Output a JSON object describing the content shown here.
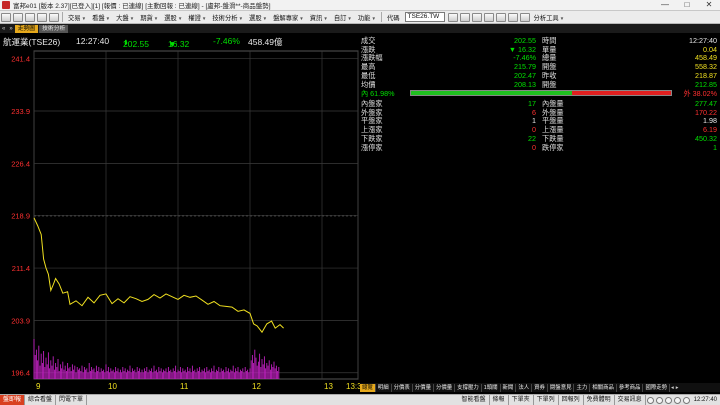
{
  "window": {
    "title": "富邦e01 [版本 2.37][已登入][1] [報價 : 已連線] [主動回報 : 已連線] - [盧邦-盤滑**-商品盤勢]",
    "minimize": "—",
    "maximize": "□",
    "close": "✕"
  },
  "menu": {
    "items": [
      "交易",
      "看盤",
      "大盤",
      "期貨",
      "選股",
      "權證",
      "技術分析",
      "選股",
      "盤解專家",
      "資訊",
      "自訂",
      "功能"
    ],
    "code_label": "代碼",
    "code_value": "TSE26.TW",
    "analysis_tools": "分析工具"
  },
  "tabs": {
    "items": [
      {
        "label": "走勢圖",
        "active": true
      },
      {
        "label": "技術分析",
        "active": false
      }
    ]
  },
  "stock": {
    "name": "航運業(TSE26)",
    "time": "12:27:40",
    "price": "202.55",
    "price_arrow": "⬇",
    "change_arrow": "▼",
    "change": "16.32",
    "change_pct": "-7.46%",
    "volume": "458.49億"
  },
  "quote": {
    "left": [
      {
        "label": "成交",
        "value": "202.55",
        "color": "g",
        "arrow": "⬇"
      },
      {
        "label": "漲跌",
        "value": "▼ 16.32",
        "color": "g"
      },
      {
        "label": "漲跌幅",
        "value": "-7.46%",
        "color": "g"
      },
      {
        "label": "最高",
        "value": "215.79",
        "color": "g"
      },
      {
        "label": "最低",
        "value": "202.47",
        "color": "g"
      },
      {
        "label": "均價",
        "value": "208.13",
        "color": "g"
      }
    ],
    "right": [
      {
        "label": "時間",
        "value": "12:27:40",
        "color": "w"
      },
      {
        "label": "單量",
        "value": "0.04",
        "color": "y"
      },
      {
        "label": "總量",
        "value": "458.49",
        "color": "y"
      },
      {
        "label": "開盤",
        "value": "558.32",
        "color": "y"
      },
      {
        "label": "昨收",
        "value": "218.87",
        "color": "y"
      },
      {
        "label": "開盤",
        "value": "212.85",
        "color": "g"
      }
    ],
    "inner_label": "內 61.98%",
    "outer_label": "外 38.02%",
    "inner_ratio": 0.6198,
    "stats_left": [
      {
        "label": "內盤家",
        "value": "17",
        "color": "g"
      },
      {
        "label": "外盤家",
        "value": "6",
        "color": "r"
      },
      {
        "label": "平盤家",
        "value": "1",
        "color": "w"
      },
      {
        "label": "上漲家",
        "value": "0",
        "color": "r"
      },
      {
        "label": "下跌家",
        "value": "22",
        "color": "g"
      },
      {
        "label": "漲停家",
        "value": "0",
        "color": "r"
      }
    ],
    "stats_right": [
      {
        "label": "內盤量",
        "value": "277.47",
        "color": "g"
      },
      {
        "label": "外盤量",
        "value": "170.22",
        "color": "r"
      },
      {
        "label": "平盤量",
        "value": "1.98",
        "color": "w"
      },
      {
        "label": "上漲量",
        "value": "6.19",
        "color": "r"
      },
      {
        "label": "下跌量",
        "value": "450.32",
        "color": "g"
      },
      {
        "label": "跌停家",
        "value": "1",
        "color": "g"
      }
    ]
  },
  "chart_data": {
    "type": "line",
    "ylim": [
      195.5,
      242.5
    ],
    "y_ticks": [
      "241.4",
      "233.9",
      "226.4",
      "218.9",
      "211.4",
      "203.9",
      "196.4"
    ],
    "y_tick_values": [
      241.4,
      233.9,
      226.4,
      218.9,
      211.4,
      203.9,
      196.4
    ],
    "x_ticks": [
      "9",
      "10",
      "11",
      "12",
      "13",
      "13:30"
    ],
    "x_tick_values": [
      0,
      60,
      120,
      180,
      240,
      270
    ],
    "xlim": [
      0,
      270
    ],
    "grid": true,
    "series": [
      {
        "x": [
          0,
          3,
          6,
          8,
          10,
          12,
          14,
          16,
          18,
          21,
          24,
          28,
          30,
          35,
          40,
          45,
          50,
          55,
          60,
          65,
          70,
          75,
          80,
          85,
          90,
          95,
          100,
          105,
          110,
          115,
          120,
          125,
          130,
          135,
          140,
          145,
          150,
          155,
          160,
          165,
          170,
          175,
          180,
          183,
          186,
          190,
          194,
          198,
          201,
          205,
          208
        ],
        "y": [
          218.6,
          217.5,
          216.2,
          212.7,
          211.4,
          210.5,
          208.2,
          209.0,
          209.9,
          209.1,
          207.8,
          208.0,
          206.2,
          206.7,
          206.0,
          207.2,
          206.4,
          207.5,
          207.7,
          206.3,
          207.0,
          206.4,
          207.3,
          207.0,
          206.6,
          206.9,
          207.6,
          207.1,
          207.7,
          207.3,
          206.9,
          207.5,
          207.2,
          207.4,
          206.8,
          206.2,
          206.6,
          206.0,
          205.9,
          205.8,
          205.2,
          205.4,
          204.9,
          203.4,
          203.1,
          202.2,
          203.4,
          203.8,
          202.8,
          203.3,
          202.8
        ]
      }
    ],
    "volume": [
      30,
      18,
      22,
      14,
      25,
      10,
      19,
      12,
      21,
      9,
      16,
      11,
      20,
      8,
      14,
      10,
      17,
      7,
      12,
      9,
      15,
      6,
      11,
      8,
      13,
      7,
      10,
      6,
      12,
      8,
      9,
      6,
      11,
      7,
      10,
      5,
      9,
      7,
      8,
      6,
      10,
      5,
      9,
      7,
      8,
      5,
      12,
      6,
      9,
      7,
      8,
      5,
      10,
      6,
      9,
      5,
      8,
      6,
      7,
      5,
      11,
      6,
      9,
      5,
      8,
      6,
      7,
      5,
      9,
      6,
      8,
      5,
      7,
      5,
      9,
      6,
      8,
      5,
      7,
      6,
      10,
      5,
      8,
      6,
      7,
      5,
      9,
      6,
      8,
      5,
      7,
      5,
      8,
      6,
      9,
      5,
      7,
      6,
      8,
      5,
      10,
      6,
      7,
      5,
      9,
      6,
      8,
      5,
      7,
      6,
      8,
      5,
      9,
      6,
      7,
      5,
      8,
      6,
      10,
      5,
      7,
      6,
      9,
      5,
      8,
      6,
      7,
      5,
      9,
      6,
      8,
      5,
      10,
      6,
      7,
      5,
      8,
      6,
      9,
      5,
      7,
      6,
      8,
      5,
      9,
      6,
      7,
      5,
      8,
      6,
      10,
      5,
      7,
      6,
      9,
      5,
      8,
      6,
      7,
      5,
      9,
      6,
      8,
      5,
      7,
      6,
      10,
      5,
      8,
      6,
      9,
      5,
      7,
      6,
      8,
      5,
      9,
      6,
      7,
      5,
      8,
      14,
      18,
      12,
      22,
      16,
      10,
      13,
      19,
      9,
      15,
      11,
      17,
      8,
      12,
      10,
      14,
      7,
      11,
      9,
      13,
      8,
      10,
      6,
      9
    ],
    "line_color": "#f0e020",
    "volume_color": "#c020c0"
  },
  "bottom_tabs": [
    "明細",
    "分價表",
    "分價量",
    "分價量",
    "支撐壓力",
    "1頭關",
    "新聞",
    "法人",
    "資券",
    "閱盤意見",
    "主力",
    "相關商品",
    "參考商品",
    "國際走勢"
  ],
  "bottom_tab_active": "總覽",
  "status": {
    "buttons_left": [
      "盤即報",
      "綜合看盤",
      "閃電下單"
    ],
    "buttons_right": [
      "智能看盤",
      "條報",
      "下單夾",
      "下單列",
      "回報列",
      "免費體明",
      "交易訊息"
    ],
    "time": "12:27:40"
  }
}
